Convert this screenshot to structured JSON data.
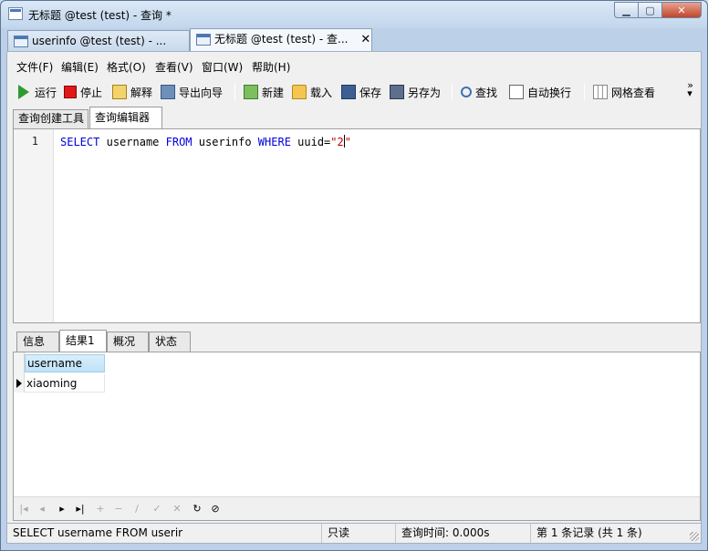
{
  "window": {
    "title": "无标题 @test (test) - 查询 *"
  },
  "doc_tabs": [
    {
      "label": "userinfo @test (test) - ...",
      "active": false
    },
    {
      "label": "无标题 @test (test) - 查...",
      "active": true,
      "close": "✕"
    }
  ],
  "menu": [
    "文件(F)",
    "编辑(E)",
    "格式(O)",
    "查看(V)",
    "窗口(W)",
    "帮助(H)"
  ],
  "toolbar": {
    "run": "运行",
    "stop": "停止",
    "explain": "解释",
    "export": "导出向导",
    "new": "新建",
    "load": "载入",
    "save": "保存",
    "saveas": "另存为",
    "find": "查找",
    "wrap": "自动换行",
    "grid": "网格查看",
    "more": "»"
  },
  "editor_tabs": [
    "查询创建工具",
    "查询编辑器"
  ],
  "editor": {
    "line_number": "1",
    "tokens": {
      "select": "SELECT",
      "col": "username",
      "from": "FROM",
      "table": "userinfo",
      "where": "WHERE",
      "cond": "uuid=",
      "q1": "\"",
      "val": "2",
      "q2": "\""
    }
  },
  "result_tabs": [
    "信息",
    "结果1",
    "概况",
    "状态"
  ],
  "result": {
    "column": "username",
    "rows": [
      "xiaoming"
    ]
  },
  "status": {
    "sql": "SELECT username FROM userir",
    "mode": "只读",
    "time": "查询时间: 0.000s",
    "records": "第 1 条记录 (共 1 条)"
  }
}
